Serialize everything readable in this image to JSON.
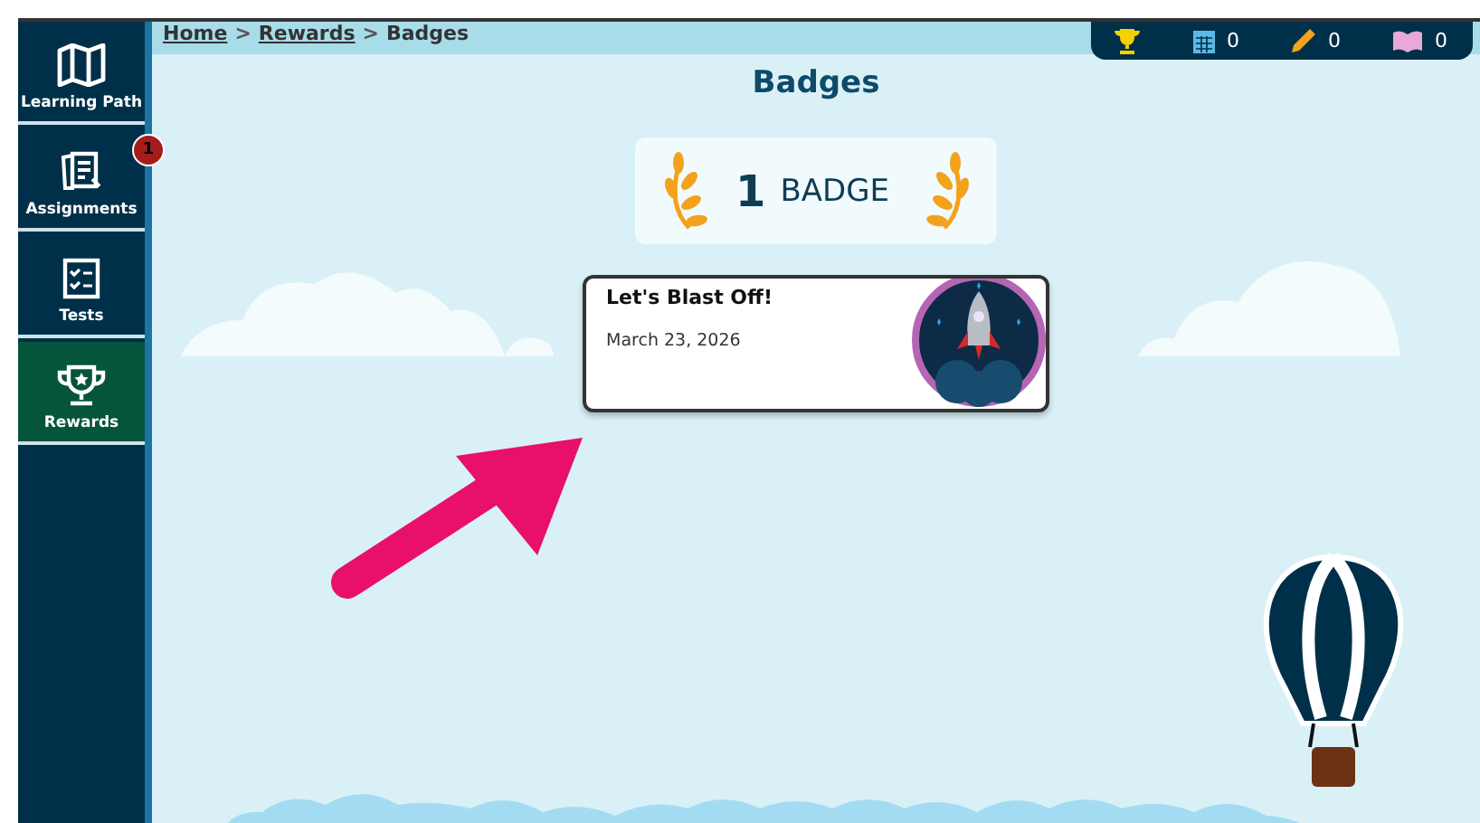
{
  "sidebar": {
    "items": [
      {
        "kind": "map",
        "label": "Learning Path",
        "selected": false
      },
      {
        "kind": "assignments",
        "label": "Assignments",
        "selected": false,
        "badge": "1"
      },
      {
        "kind": "tests",
        "label": "Tests",
        "selected": false
      },
      {
        "kind": "trophy",
        "label": "Rewards",
        "selected": true
      }
    ]
  },
  "breadcrumb": [
    {
      "label": "Home",
      "link": true
    },
    {
      "label": ">",
      "link": false
    },
    {
      "label": "Rewards",
      "link": true
    },
    {
      "label": ">",
      "link": false
    },
    {
      "label": "Badges",
      "link": false
    }
  ],
  "stats": [
    {
      "kind": "trophy"
    },
    {
      "kind": "calendar",
      "value": "0"
    },
    {
      "kind": "pencil",
      "value": "0"
    },
    {
      "kind": "book",
      "value": "0"
    }
  ],
  "title": "Badges",
  "summary": {
    "count": "1",
    "label": "BADGE"
  },
  "badges": [
    {
      "title": "Let's Blast Off!",
      "date": "March 23, 2026"
    }
  ]
}
